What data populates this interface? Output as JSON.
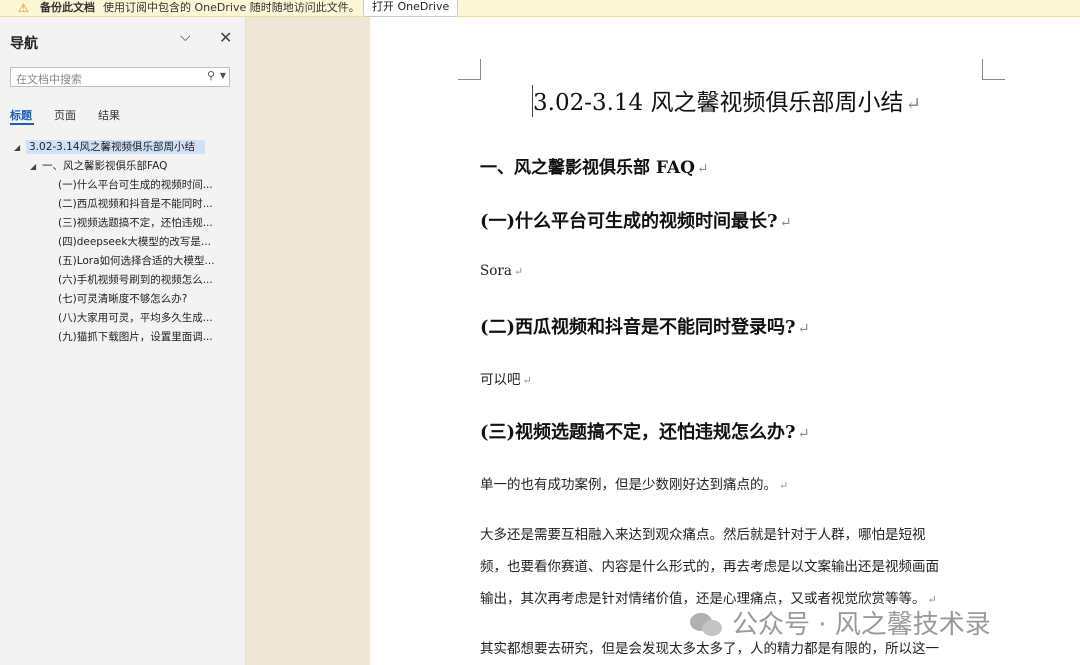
{
  "notification": {
    "icon": "warning-icon",
    "title": "备份此文档",
    "message": "使用订阅中包含的 OneDrive 随时随地访问此文件。",
    "button": "打开 OneDrive"
  },
  "nav": {
    "title": "导航",
    "search_placeholder": "在文档中搜索",
    "tabs": [
      "标题",
      "页面",
      "结果"
    ],
    "active_tab": "标题",
    "tree": {
      "root": "3.02-3.14风之馨视频俱乐部周小结",
      "section": "一、风之馨影视俱乐部FAQ",
      "items": [
        "(一)什么平台可生成的视频时间...",
        "(二)西瓜视频和抖音是不能同时...",
        "(三)视频选题搞不定，还怕违规...",
        "(四)deepseek大模型的改写是...",
        "(五)Lora如何选择合适的大模型...",
        "(六)手机视频号刷到的视频怎么...",
        "(七)可灵清晰度不够怎么办?",
        "(八)大家用可灵，平均多久生成...",
        "(九)猫抓下载图片，设置里面调..."
      ]
    }
  },
  "document": {
    "title": "3.02-3.14 风之馨视频俱乐部周小结",
    "section_heading": "一、风之馨影视俱乐部 FAQ",
    "q1": "(一)什么平台可生成的视频时间最长?",
    "a1": "Sora",
    "q2": "(二)西瓜视频和抖音是不能同时登录吗?",
    "a2": "可以吧",
    "q3": "(三)视频选题搞不定，还怕违规怎么办?",
    "a3_line1": "单一的也有成功案例，但是少数刚好达到痛点的。",
    "a3_p2_line1": "大多还是需要互相融入来达到观众痛点。然后就是针对于人群，哪怕是短视",
    "a3_p2_line2": "频，也要看你赛道、内容是什么形式的，再去考虑是以文案输出还是视频画面",
    "a3_p2_line3": "输出，其次再考虑是针对情绪价值，还是心理痛点，又或者视觉欣赏等等。",
    "a3_p3_line1": "其实都想要去研究，但是会发现太多太多了，人的精力都是有限的，所以这一",
    "paragraph_mark": "↵"
  },
  "watermark": "公众号 · 风之馨技术录"
}
